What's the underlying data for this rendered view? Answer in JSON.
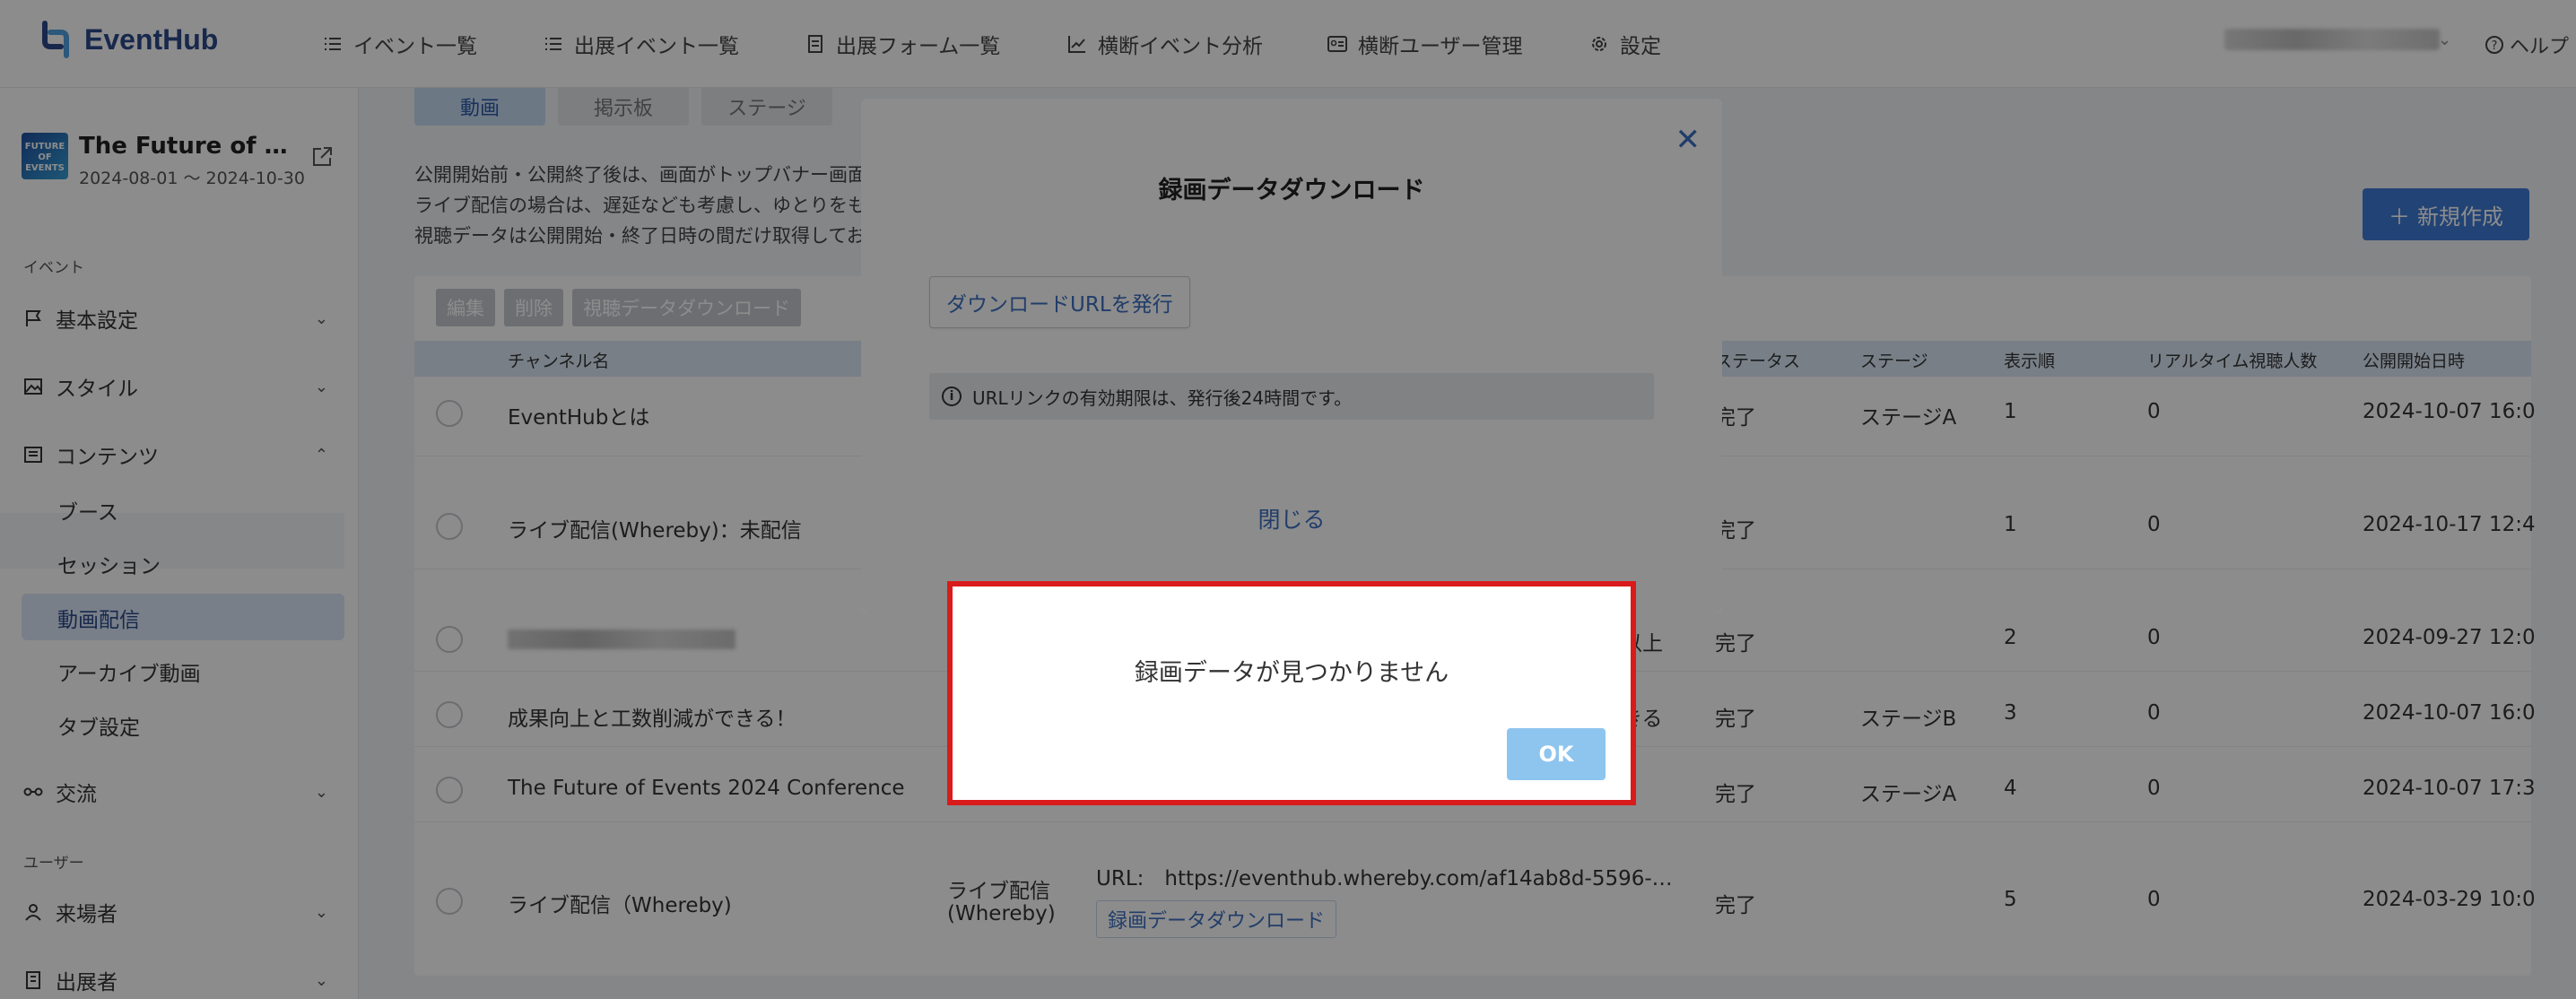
{
  "app": {
    "name": "EventHub"
  },
  "topnav": {
    "items": [
      {
        "label": "イベント一覧",
        "icon": "list-icon"
      },
      {
        "label": "出展イベント一覧",
        "icon": "list-icon"
      },
      {
        "label": "出展フォーム一覧",
        "icon": "document-icon"
      },
      {
        "label": "横断イベント分析",
        "icon": "chart-icon"
      },
      {
        "label": "横断ユーザー管理",
        "icon": "id-card-icon"
      },
      {
        "label": "設定",
        "icon": "gear-icon"
      }
    ],
    "help": "ヘルプ"
  },
  "sidebar": {
    "event_title": "The Future of Eve…",
    "event_dates": "2024-08-01 ～ 2024-10-30",
    "thumb_text": "FUTURE OF EVENTS",
    "section_event": "イベント",
    "section_user": "ユーザー",
    "items": {
      "basic": "基本設定",
      "style": "スタイル",
      "contents": "コンテンツ",
      "booth": "ブース",
      "session": "セッション",
      "video": "動画配信",
      "archive": "アーカイブ動画",
      "tabs": "タブ設定",
      "exchange": "交流",
      "visitors": "来場者",
      "exhibitors": "出展者"
    }
  },
  "main": {
    "tabs": [
      "動画",
      "掲示板",
      "ステージ"
    ],
    "desc": [
      "公開開始前・公開終了後は、画面がトップバナー画面",
      "ライブ配信の場合は、遅延なども考慮し、ゆとりをも",
      "視聴データは公開開始・終了日時の間だけ取得してお"
    ],
    "new_button": "新規作成",
    "toolbar": [
      "編集",
      "削除",
      "視聴データダウンロード"
    ],
    "headers": {
      "channel": "チャンネル名",
      "status": "ステータス",
      "stage": "ステージ",
      "order": "表示順",
      "realtime": "リアルタイム視聴人数",
      "start": "公開開始日時"
    },
    "rows": [
      {
        "name": "EventHubとは",
        "extra": "",
        "status": "完了",
        "stage": "ステージA",
        "order": "1",
        "viewers": "0",
        "start": "2024-10-07 16:0"
      },
      {
        "name": "ライブ配信(Whereby)：未配信",
        "extra": "",
        "status": "完了",
        "stage": "",
        "order": "1",
        "viewers": "0",
        "start": "2024-10-17 12:4"
      },
      {
        "name": "",
        "extra": "以上",
        "status": "完了",
        "stage": "",
        "order": "2",
        "viewers": "0",
        "start": "2024-09-27 12:0"
      },
      {
        "name": "成果向上と工数削減ができる！",
        "extra": "きる",
        "status": "完了",
        "stage": "ステージB",
        "order": "3",
        "viewers": "0",
        "start": "2024-10-07 16:0"
      },
      {
        "name": "The Future of Events 2024 Conference",
        "extra": "",
        "status": "完了",
        "stage": "ステージA",
        "order": "4",
        "viewers": "0",
        "start": "2024-10-07 17:3"
      },
      {
        "name": "ライブ配信（Whereby)",
        "extra": "",
        "status": "完了",
        "stage": "",
        "order": "5",
        "viewers": "0",
        "start": "2024-03-29 10:0"
      }
    ],
    "last_row": {
      "type_line1": "ライブ配信",
      "type_line2": "(Whereby)",
      "url": "URL:　https://eventhub.whereby.com/af14ab8d-5596-…",
      "download": "録画データダウンロード"
    }
  },
  "modal": {
    "title": "録画データダウンロード",
    "issue_button": "ダウンロードURLを発行",
    "info": "URLリンクの有効期限は、発行後24時間です。",
    "close": "閉じる"
  },
  "alert": {
    "message": "録画データが見つかりません",
    "ok": "OK"
  },
  "colors": {
    "primary": "#3e7bd6",
    "alert_border": "#d91b1b",
    "ok_button": "#8ec5ef"
  }
}
